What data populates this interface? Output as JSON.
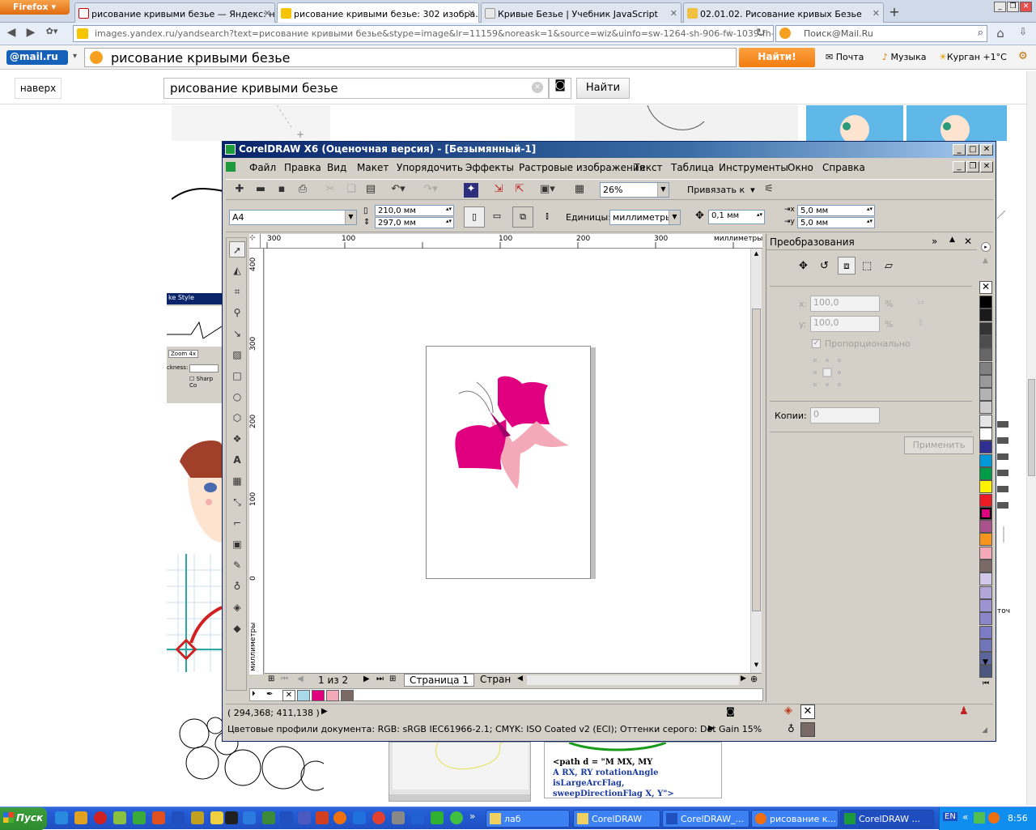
{
  "firefox": {
    "menu_label": "Firefox",
    "tabs": [
      {
        "label": "рисование кривыми безье — Яндекс: н...",
        "active": false
      },
      {
        "label": "рисование кривыми безье: 302 изобра...",
        "active": true
      },
      {
        "label": "Кривые Безье | Учебник JavaScript",
        "active": false
      },
      {
        "label": "02.01.02. Рисование кривых Безье",
        "active": false
      }
    ],
    "new_tab": "+",
    "url": "images.yandex.ru/yandsearch?text=рисование кривыми безье&stype=image&lr=11159&noreask=1&source=wiz&uinfo=sw-1264-sh-906-fw-1039-fh-598-pd",
    "search_placeholder": "Поиск@Mail.Ru"
  },
  "mailru": {
    "logo": "@mail.ru",
    "query": "рисование кривыми безье",
    "find_button": "Найти!",
    "links": [
      "Почта",
      "Музыка",
      "Курган +1°C"
    ]
  },
  "yandex": {
    "up_button": "наверх",
    "search_value": "рисование кривыми безье",
    "find_button": "Найти",
    "snippet_style": "ke Style",
    "snippet_zoom": "Zoom 4x",
    "snippet_thickness": "ckness:",
    "snippet_sharp": "Sharp Co",
    "snippet_code_line1": "<path d = \"M  MX, MY",
    "snippet_code_line2": "A RX, RY  rotationAngle  isLargeArcFlag,",
    "snippet_code_line3": "sweepDirectionFlag  X, Y\">",
    "snippet_toch": "точ"
  },
  "corel": {
    "title": "CorelDRAW X6 (Оценочная версия) - [Безымянный-1]",
    "menu": [
      "Файл",
      "Правка",
      "Вид",
      "Макет",
      "Упорядочить",
      "Эффекты",
      "Растровые изображения",
      "Текст",
      "Таблица",
      "Инструменты",
      "Окно",
      "Справка"
    ],
    "zoom": "26%",
    "snap_label": "Привязать к",
    "page_size": "A4",
    "width": "210,0 мм",
    "height": "297,0 мм",
    "units_label": "Единицы:",
    "units_value": "миллиметры",
    "nudge": "0,1 мм",
    "dup_x": "5,0 мм",
    "dup_y": "5,0 мм",
    "ruler_top_ticks": [
      "300",
      "100",
      "100",
      "200",
      "300"
    ],
    "ruler_unit": "миллиметры",
    "ruler_left_ticks": [
      "400",
      "300",
      "200",
      "100",
      "0"
    ],
    "ruler_left_unit": "миллиметры",
    "page_counter": "1 из 2",
    "page_tab_1": "Страница 1",
    "page_tab_2": "Стран",
    "docker": {
      "title": "Преобразования",
      "scale_x": "100,0",
      "scale_y": "100,0",
      "percent": "%",
      "label_x": "x:",
      "label_y": "y:",
      "proportional": "Пропорционально",
      "copies_label": "Копии:",
      "copies_value": "0",
      "apply": "Применить"
    },
    "status_coords": "( 294,368; 411,138 )",
    "status_profiles": "Цветовые профили документа: RGB: sRGB IEC61966-2.1; CMYK: ISO Coated v2 (ECI); Оттенки серого: Dot Gain 15%",
    "doc_palette": [
      "#a8d8ea",
      "#e0007f",
      "#f4a9b8",
      "#7a6a66"
    ],
    "color_palette": [
      "#000000",
      "#1a1a1a",
      "#333333",
      "#4d4d4d",
      "#666666",
      "#808080",
      "#999999",
      "#b3b3b3",
      "#cccccc",
      "#e6e6e6",
      "#ffffff",
      "#2e3192",
      "#0098d8",
      "#009b48",
      "#fff200",
      "#ed1c24",
      "#e0007f",
      "#a8518a",
      "#f7941d",
      "#f4a9b8",
      "#7a6a66",
      "#cfc8e8",
      "#b0a6d8",
      "#9b93d2",
      "#8a86c9",
      "#7c7cc4",
      "#6f75b8",
      "#5d659e",
      "#4d567f"
    ]
  },
  "taskbar": {
    "start": "Пуск",
    "tasks": [
      "лаб",
      "CorelDRAW",
      "CorelDRAW_...",
      "рисование к...",
      "CorelDRAW ..."
    ],
    "lang": "EN",
    "clock": "8:56"
  }
}
